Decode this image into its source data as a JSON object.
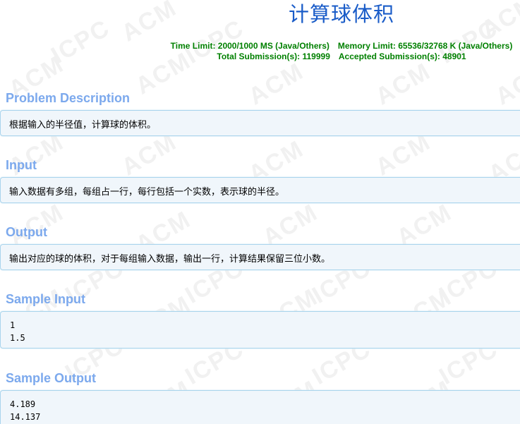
{
  "problem": {
    "title": "计算球体积",
    "limits": {
      "time_limit": "Time Limit: 2000/1000 MS (Java/Others)",
      "memory_limit": "Memory Limit: 65536/32768 K (Java/Others)",
      "total_submissions": "Total Submission(s): 119999",
      "accepted_submissions": "Accepted Submission(s): 48901"
    }
  },
  "sections": {
    "description": {
      "heading": "Problem Description",
      "text": "根据输入的半径值，计算球的体积。"
    },
    "input": {
      "heading": "Input",
      "text": "输入数据有多组，每组占一行，每行包括一个实数，表示球的半径。"
    },
    "output": {
      "heading": "Output",
      "text": "输出对应的球的体积，对于每组输入数据，输出一行，计算结果保留三位小数。"
    },
    "sample_input": {
      "heading": "Sample Input",
      "lines": [
        "1",
        "1.5"
      ]
    },
    "sample_output": {
      "heading": "Sample Output",
      "lines": [
        "4.189",
        "14.137"
      ]
    }
  },
  "watermark": {
    "text_acm": "ACM",
    "text_icpc": "ICPC"
  }
}
